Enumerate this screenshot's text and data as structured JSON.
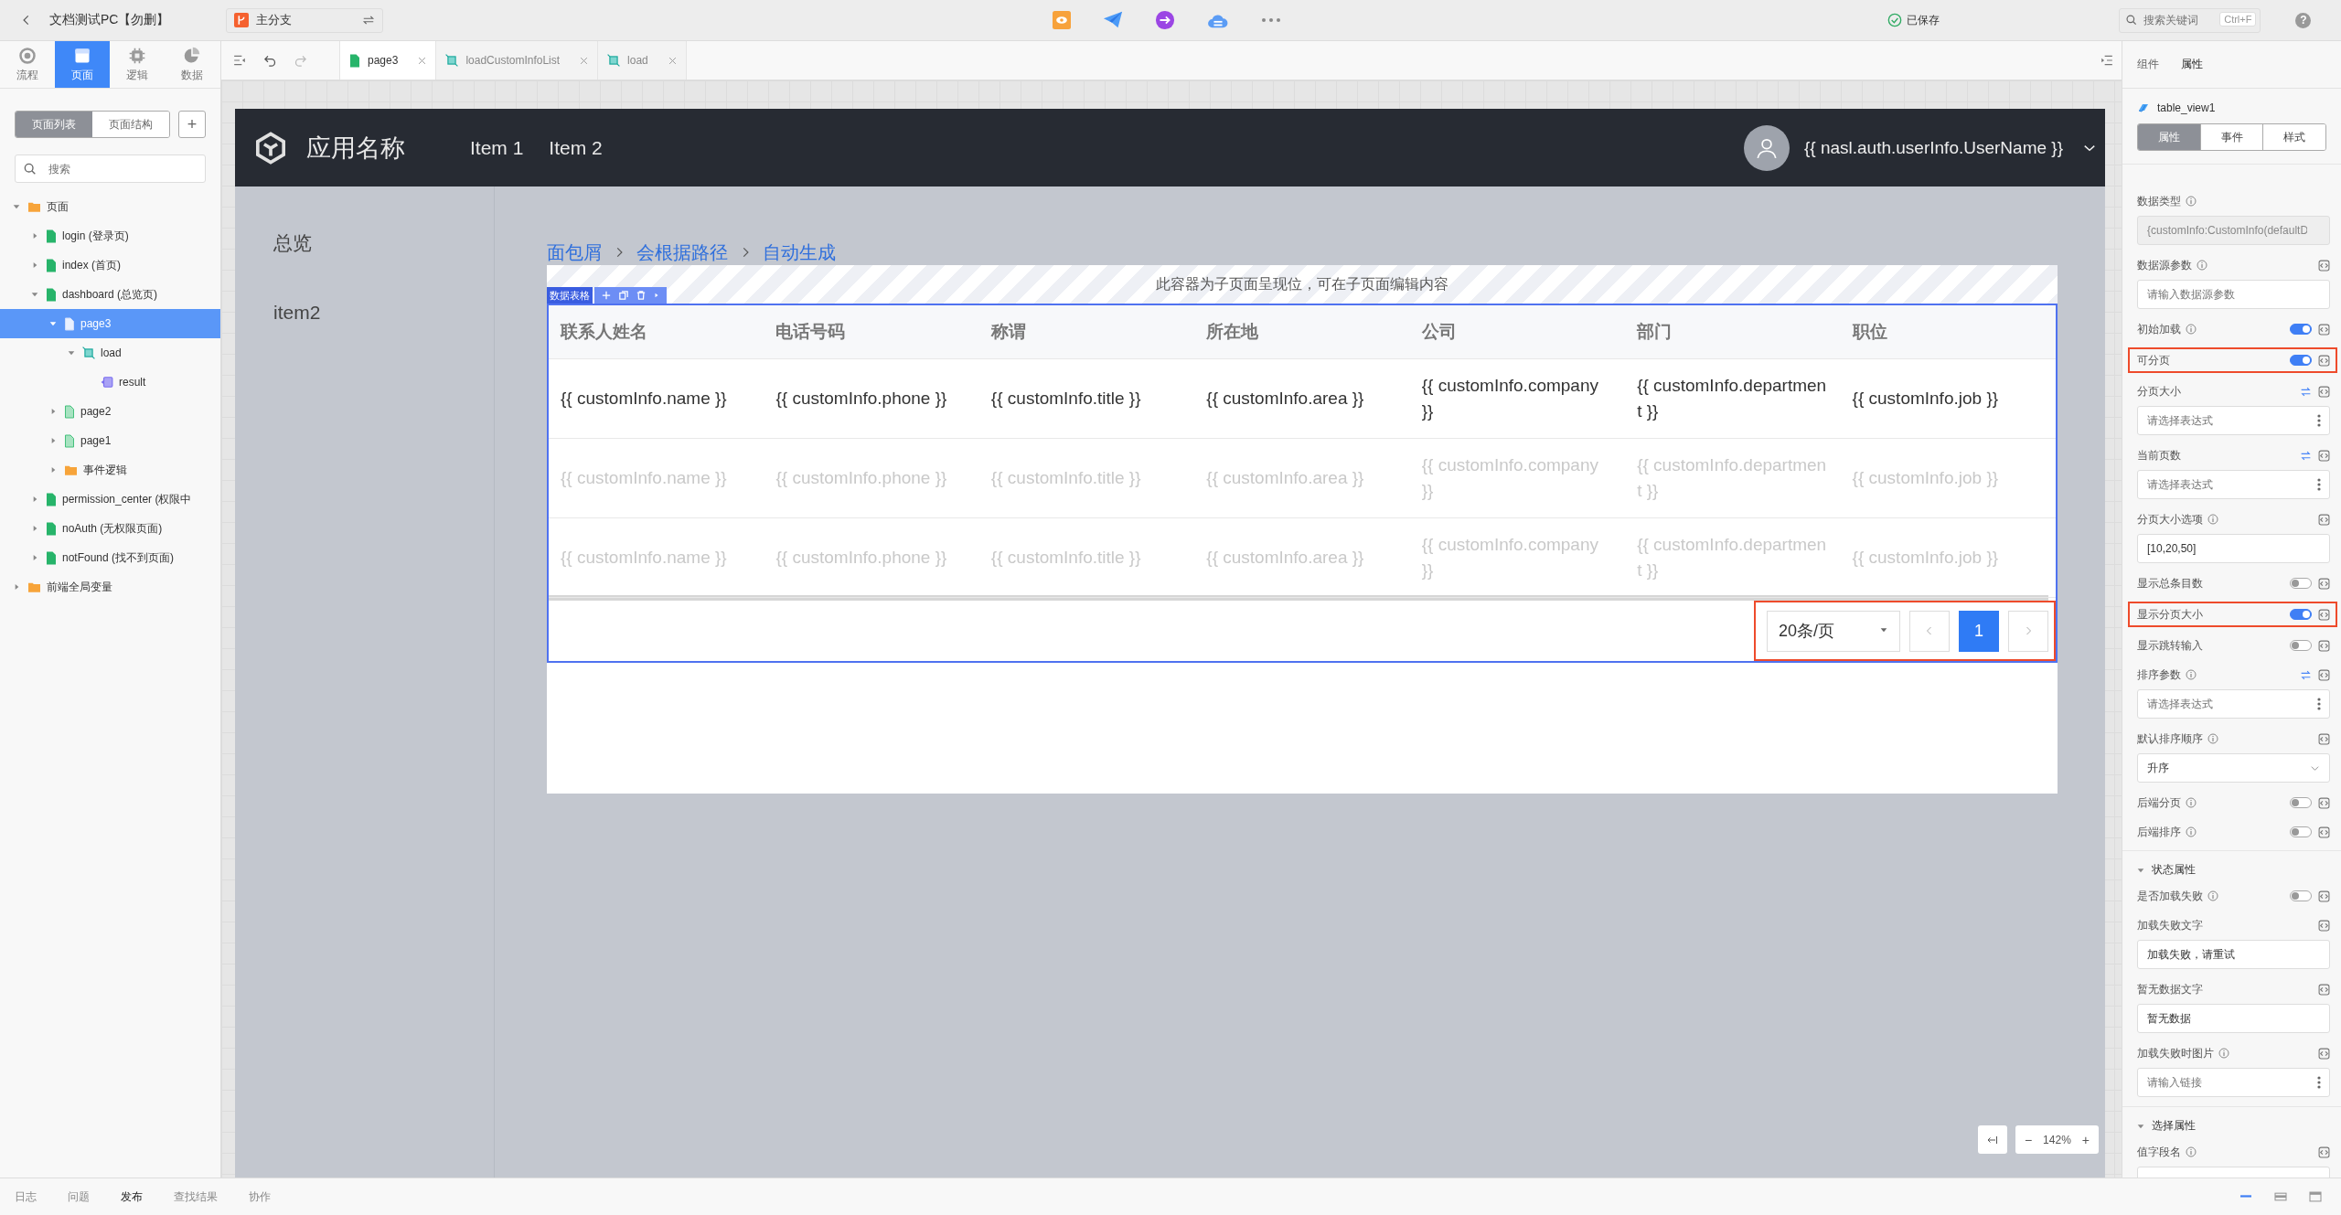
{
  "topbar": {
    "title": "文档测试PC【勿删】",
    "branch": "主分支",
    "saved": "已保存",
    "search_placeholder": "搜索关键词",
    "shortcut": "Ctrl+F",
    "help": "?"
  },
  "left_tabs": [
    {
      "label": "流程",
      "selected": false
    },
    {
      "label": "页面",
      "selected": true
    },
    {
      "label": "逻辑",
      "selected": false
    },
    {
      "label": "数据",
      "selected": false
    }
  ],
  "page_panel": {
    "views": [
      {
        "label": "页面列表",
        "selected": true
      },
      {
        "label": "页面结构",
        "selected": false
      }
    ],
    "add": "+",
    "search_placeholder": "搜索"
  },
  "tree": [
    {
      "label": "页面",
      "kind": "folder",
      "expanded": true,
      "selected": false,
      "children": [
        {
          "label": "login (登录页)",
          "kind": "page",
          "expanded": false,
          "selected": false
        },
        {
          "label": "index (首页)",
          "kind": "page",
          "expanded": false,
          "selected": false
        },
        {
          "label": "dashboard (总览页)",
          "kind": "page",
          "expanded": true,
          "selected": false,
          "children": [
            {
              "label": "page3",
              "kind": "subpage",
              "expanded": true,
              "selected": true,
              "children": [
                {
                  "label": "load",
                  "kind": "logic",
                  "expanded": true,
                  "selected": false,
                  "children": [
                    {
                      "label": "result",
                      "kind": "variable",
                      "selected": false
                    }
                  ]
                }
              ]
            },
            {
              "label": "page2",
              "kind": "subpage",
              "expanded": false,
              "selected": false
            },
            {
              "label": "page1",
              "kind": "subpage",
              "expanded": false,
              "selected": false
            },
            {
              "label": "事件逻辑",
              "kind": "folder",
              "expanded": false,
              "selected": false
            }
          ]
        },
        {
          "label": "permission_center (权限中",
          "kind": "page",
          "expanded": false,
          "selected": false
        },
        {
          "label": "noAuth (无权限页面)",
          "kind": "page",
          "expanded": false,
          "selected": false
        },
        {
          "label": "notFound (找不到页面)",
          "kind": "page",
          "expanded": false,
          "selected": false
        }
      ]
    },
    {
      "label": "前端全局变量",
      "kind": "folder",
      "expanded": false,
      "selected": false
    }
  ],
  "editor_tabs": [
    {
      "label": "page3",
      "kind": "page",
      "selected": true
    },
    {
      "label": "loadCustomInfoList",
      "kind": "logic",
      "selected": false
    },
    {
      "label": "load",
      "kind": "logic",
      "selected": false
    }
  ],
  "app": {
    "name": "应用名称",
    "nav": [
      "Item 1",
      "Item 2"
    ],
    "user": "{{ nasl.auth.userInfo.UserName }}",
    "side_nav": [
      "总览",
      "item2"
    ],
    "breadcrumb": [
      "面包屑",
      "会根据路径",
      "自动生成"
    ],
    "placeholder_note": "此容器为子页面呈现位，可在子页面编辑内容",
    "component_label": "数据表格",
    "table": {
      "columns": [
        "联系人姓名",
        "电话号码",
        "称谓",
        "所在地",
        "公司",
        "部门",
        "职位"
      ],
      "rows": [
        {
          "muted": false,
          "cells": [
            "{{ customInfo.name }}",
            "{{ customInfo.phone }}",
            "{{ customInfo.title }}",
            "{{ customInfo.area }}",
            "{{ customInfo.company }}",
            "{{ customInfo.department }}",
            "{{ customInfo.job }}"
          ]
        },
        {
          "muted": true,
          "cells": [
            "{{ customInfo.name }}",
            "{{ customInfo.phone }}",
            "{{ customInfo.title }}",
            "{{ customInfo.area }}",
            "{{ customInfo.company }}",
            "{{ customInfo.department }}",
            "{{ customInfo.job }}"
          ]
        },
        {
          "muted": true,
          "cells": [
            "{{ customInfo.name }}",
            "{{ customInfo.phone }}",
            "{{ customInfo.title }}",
            "{{ customInfo.area }}",
            "{{ customInfo.company }}",
            "{{ customInfo.department }}",
            "{{ customInfo.job }}"
          ]
        }
      ]
    },
    "pagination": {
      "highlighted": true,
      "page_size": "20条/页",
      "pages": [
        {
          "label": "1",
          "selected": true
        }
      ]
    }
  },
  "zoom": {
    "out": "−",
    "level_text": "142%",
    "in": "+"
  },
  "right_panel": {
    "tabs": [
      {
        "label": "组件",
        "selected": false
      },
      {
        "label": "属性",
        "selected": true
      }
    ],
    "component": "table_view1",
    "segments": [
      {
        "label": "属性",
        "selected": true
      },
      {
        "label": "事件",
        "selected": false
      },
      {
        "label": "样式",
        "selected": false
      }
    ],
    "groups": [
      {
        "properties": [
          {
            "kind": "input",
            "label": "数据类型",
            "info": true,
            "bind": false,
            "code": false,
            "menu": false,
            "disabled": true,
            "highlighted": false,
            "value": "{customInfo:CustomInfo(defaultD"
          },
          {
            "kind": "input",
            "label": "数据源参数",
            "info": true,
            "bind": false,
            "code": true,
            "menu": false,
            "disabled": false,
            "highlighted": false,
            "placeholder": "请输入数据源参数"
          },
          {
            "kind": "toggle",
            "label": "初始加载",
            "info": true,
            "code": true,
            "on": true,
            "highlighted": false
          },
          {
            "kind": "toggle",
            "label": "可分页",
            "info": false,
            "code": true,
            "on": true,
            "highlighted": true
          },
          {
            "kind": "input",
            "label": "分页大小",
            "info": false,
            "bind": true,
            "code": true,
            "menu": true,
            "disabled": false,
            "highlighted": false,
            "placeholder": "请选择表达式"
          },
          {
            "kind": "input",
            "label": "当前页数",
            "info": false,
            "bind": true,
            "code": true,
            "menu": true,
            "disabled": false,
            "highlighted": false,
            "placeholder": "请选择表达式"
          },
          {
            "kind": "input",
            "label": "分页大小选项",
            "info": true,
            "bind": false,
            "code": true,
            "menu": false,
            "disabled": false,
            "highlighted": false,
            "value": "[10,20,50]"
          },
          {
            "kind": "toggle",
            "label": "显示总条目数",
            "info": false,
            "code": true,
            "on": false,
            "highlighted": false
          },
          {
            "kind": "toggle",
            "label": "显示分页大小",
            "info": false,
            "code": true,
            "on": true,
            "highlighted": true
          },
          {
            "kind": "toggle",
            "label": "显示跳转输入",
            "info": false,
            "code": true,
            "on": false,
            "highlighted": false
          },
          {
            "kind": "input",
            "label": "排序参数",
            "info": true,
            "bind": true,
            "code": true,
            "menu": true,
            "disabled": false,
            "highlighted": false,
            "placeholder": "请选择表达式"
          },
          {
            "kind": "select",
            "label": "默认排序顺序",
            "info": true,
            "code": true,
            "highlighted": false,
            "value": "升序"
          },
          {
            "kind": "toggle",
            "label": "后端分页",
            "info": true,
            "code": true,
            "on": false,
            "highlighted": false
          },
          {
            "kind": "toggle",
            "label": "后端排序",
            "info": true,
            "code": true,
            "on": false,
            "highlighted": false
          }
        ]
      },
      {
        "title": "状态属性",
        "expanded": true,
        "properties": [
          {
            "kind": "toggle",
            "label": "是否加载失败",
            "info": true,
            "code": true,
            "on": false,
            "highlighted": false
          },
          {
            "kind": "input",
            "label": "加载失败文字",
            "info": false,
            "bind": false,
            "code": true,
            "menu": false,
            "disabled": false,
            "highlighted": false,
            "value": "加载失败，请重试"
          },
          {
            "kind": "input",
            "label": "暂无数据文字",
            "info": false,
            "bind": false,
            "code": true,
            "menu": false,
            "disabled": false,
            "highlighted": false,
            "value": "暂无数据"
          },
          {
            "kind": "input",
            "label": "加载失败时图片",
            "info": true,
            "bind": false,
            "code": true,
            "menu": true,
            "disabled": false,
            "highlighted": false,
            "placeholder": "请输入链接"
          }
        ]
      },
      {
        "title": "选择属性",
        "expanded": true,
        "properties": [
          {
            "kind": "input",
            "label": "值字段名",
            "info": true,
            "bind": false,
            "code": true,
            "menu": false,
            "disabled": false,
            "highlighted": false
          }
        ]
      }
    ]
  },
  "bottom_tabs": [
    {
      "label": "日志",
      "selected": false
    },
    {
      "label": "问题",
      "selected": false
    },
    {
      "label": "发布",
      "selected": true
    },
    {
      "label": "查找结果",
      "selected": false
    },
    {
      "label": "协作",
      "selected": false
    }
  ],
  "layouts": [
    {
      "selected": true
    },
    {
      "selected": false
    },
    {
      "selected": false
    }
  ]
}
